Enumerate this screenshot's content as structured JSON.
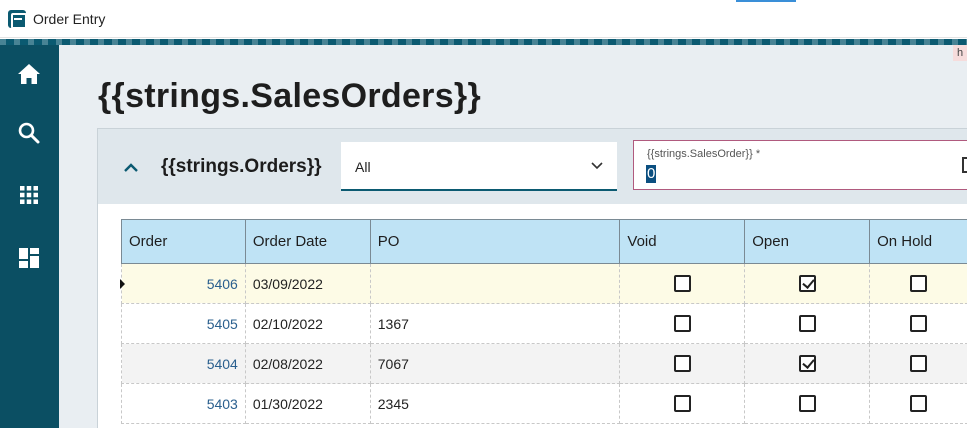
{
  "window": {
    "title": "Order Entry",
    "corner_text": "h"
  },
  "sidebar": {
    "items": [
      {
        "name": "home",
        "icon": "home-icon"
      },
      {
        "name": "search",
        "icon": "search-icon"
      },
      {
        "name": "apps",
        "icon": "grid-icon"
      },
      {
        "name": "dashboard",
        "icon": "dashboard-icon"
      }
    ]
  },
  "page": {
    "title": "{{strings.SalesOrders}}"
  },
  "panel": {
    "title": "{{strings.Orders}}",
    "filter": {
      "value": "All"
    },
    "sales_order_field": {
      "label": "{{strings.SalesOrder}} *",
      "value": "0"
    }
  },
  "grid": {
    "columns": [
      "Order",
      "Order Date",
      "PO",
      "Void",
      "Open",
      "On Hold"
    ],
    "rows": [
      {
        "order": "5406",
        "date": "03/09/2022",
        "po": "",
        "void": false,
        "open": true,
        "on_hold": false
      },
      {
        "order": "5405",
        "date": "02/10/2022",
        "po": "1367",
        "void": false,
        "open": false,
        "on_hold": false
      },
      {
        "order": "5404",
        "date": "02/08/2022",
        "po": "7067",
        "void": false,
        "open": true,
        "on_hold": false
      },
      {
        "order": "5403",
        "date": "01/30/2022",
        "po": "2345",
        "void": false,
        "open": false,
        "on_hold": false
      }
    ]
  },
  "colors": {
    "sidebar": "#0b4f63",
    "header_cell": "#bfe3f5",
    "selected_row": "#fdfbe6",
    "link": "#2a5f8e"
  }
}
